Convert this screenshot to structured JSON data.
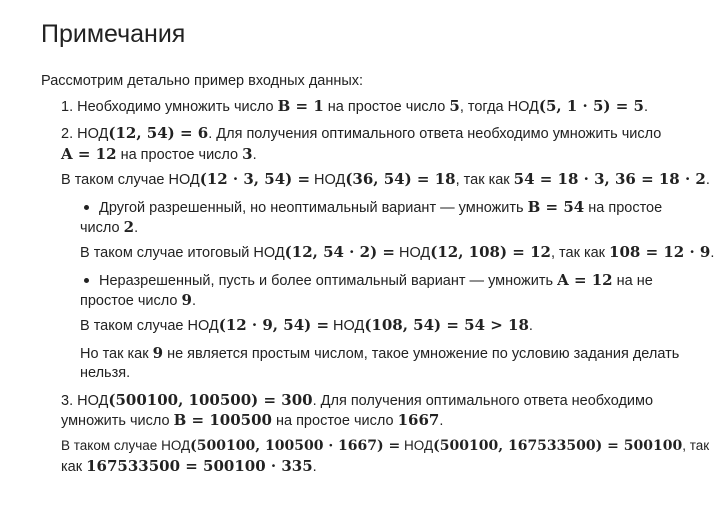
{
  "title": "Примечания",
  "intro": "Рассмотрим детально пример входных данных:",
  "item1": {
    "num": "1.",
    "a": "Необходимо умножить число",
    "b": "B = 1",
    "c": "на простое число",
    "d": "5",
    "e": ", тогда НОД",
    "f": "(5, 1 · 5) = 5",
    "g": "."
  },
  "item2": {
    "num": "2.",
    "l1a": "НОД",
    "l1b": "(12, 54) = 6",
    "l1c": ". Для получения оптимального ответа необходимо умножить число",
    "l2a": "A = 12",
    "l2b": "на простое число",
    "l2c": "3",
    "l2d": ".",
    "l3a": "В таком случае НОД",
    "l3b": "(12 · 3, 54) =",
    "l3c": "НОД",
    "l3d": "(36, 54) = 18",
    "l3e": ", так как",
    "l3f": "54 = 18 · 3, 36 = 18 · 2",
    "l3g": "."
  },
  "bullet1": {
    "l1a": "Другой разрешенный, но неоптимальный вариант  — умножить",
    "l1b": "B = 54",
    "l1c": "на простое",
    "l2a": "число",
    "l2b": "2",
    "l2c": ".",
    "l3a": "В таком случае итоговый НОД",
    "l3b": "(12, 54 · 2) =",
    "l3c": "НОД",
    "l3d": "(12, 108) = 12",
    "l3e": ", так как",
    "l3f": "108 = 12 · 9",
    "l3g": "."
  },
  "bullet2": {
    "l1a": "Неразрешенный, пусть и более оптимальный вариант  — умножить",
    "l1b": "A = 12",
    "l1c": "на не",
    "l2a": "простое число",
    "l2b": "9",
    "l2c": ".",
    "l3a": "В таком случае НОД",
    "l3b": "(12 · 9, 54) =",
    "l3c": "НОД",
    "l3d": "(108, 54) = 54 > 18",
    "l3e": ".",
    "l4a": "Но так как",
    "l4b": "9",
    "l4c": "не является простым числом, такое умножение по условию задания делать",
    "l5": "нельзя."
  },
  "item3": {
    "num": "3.",
    "l1a": "НОД",
    "l1b": "(500100, 100500) = 300",
    "l1c": ". Для получения оптимального ответа необходимо",
    "l2a": "умножить число",
    "l2b": "B = 100500",
    "l2c": "на простое число",
    "l2d": "1667",
    "l2e": ".",
    "l3a": "В таком случае НОД",
    "l3b": "(500100, 100500 · 1667) =",
    "l3c": "НОД",
    "l3d": "(500100, 167533500) = 500100",
    "l3e": ", так",
    "l4a": "как",
    "l4b": "167533500 = 500100 · 335",
    "l4c": "."
  }
}
